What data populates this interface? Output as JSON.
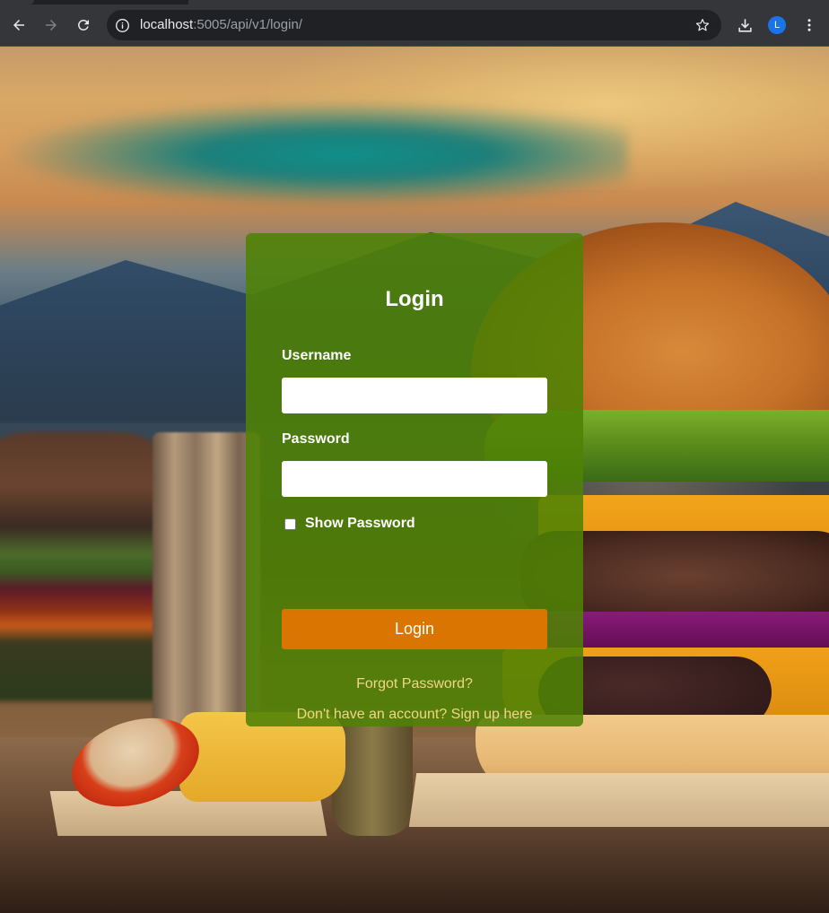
{
  "browser": {
    "url_host": "localhost",
    "url_path": ":5005/api/v1/login/",
    "profile_initial": "L",
    "icons": {
      "back": "arrow-left-icon",
      "forward": "arrow-right-icon",
      "reload": "reload-icon",
      "site_info": "info-icon",
      "bookmark": "star-icon",
      "download": "download-icon",
      "menu": "kebab-menu-icon"
    }
  },
  "login": {
    "title": "Login",
    "username_label": "Username",
    "username_value": "",
    "password_label": "Password",
    "password_value": "",
    "show_password_label": "Show Password",
    "show_password_checked": false,
    "submit_label": "Login",
    "forgot_password_link": "Forgot Password?",
    "signup_link": "Don't have an account? Sign up here"
  },
  "colors": {
    "card_background": "#4f8204",
    "button_background": "#db7502",
    "link_color": "#f3d58a",
    "text_color": "#ffffff"
  }
}
